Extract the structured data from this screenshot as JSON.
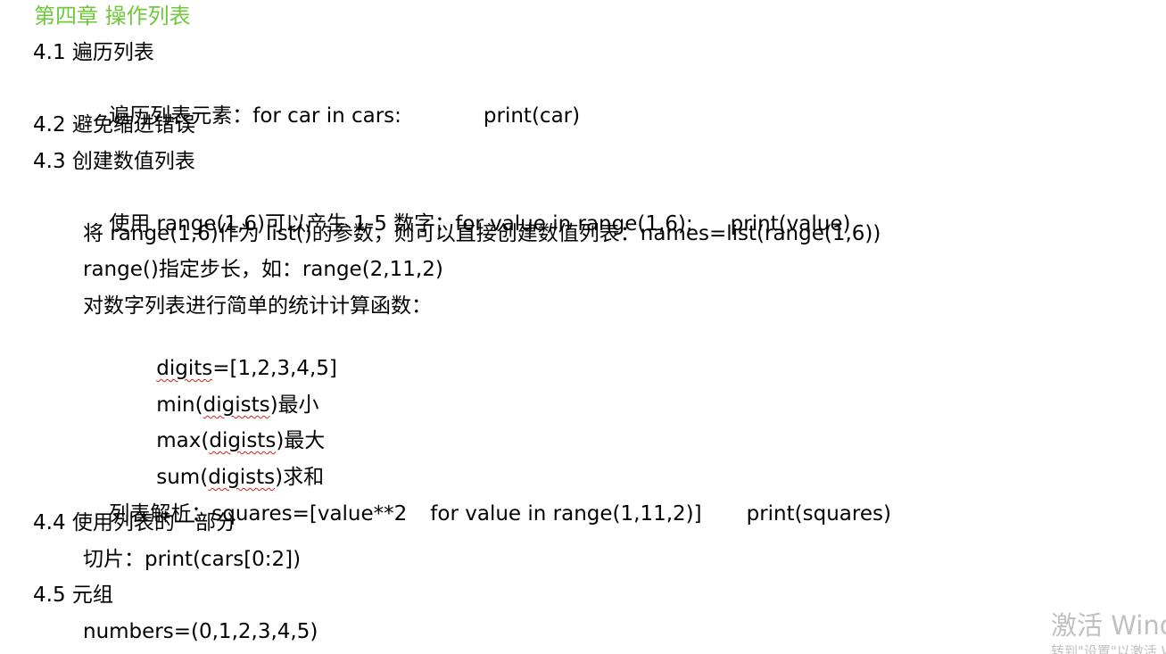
{
  "chapter_title": "第四章 操作列表",
  "colors": {
    "chapter": "#70c83c",
    "text": "#000000",
    "watermark": "#c0c0c0",
    "spell_underline": "#cc2222"
  },
  "s41": {
    "heading": "4.1 遍历列表",
    "loop_text": "遍历列表元素：for car in cars:",
    "loop_code": "print(car)"
  },
  "s42": {
    "heading": "4.2 避免缩进错误"
  },
  "s43": {
    "heading": "4.3 创建数值列表",
    "range_text": "使用 range(1,6)可以产生 1-5 数字：for value in range(1,6):",
    "range_code": "print(value)",
    "list_text": "将 range(1,6)作为 list()的参数，则可以直接创建数值列表：names=list(range(1,6))",
    "step_text": "range()指定步长，如：range(2,11,2)",
    "stats_intro": "对数字列表进行简单的统计计算函数：",
    "digits": {
      "word": "digits",
      "rest": "=[1,2,3,4,5]"
    },
    "min": {
      "pre": "min(",
      "word": "digists",
      "post": ")最小"
    },
    "max": {
      "pre": "max(",
      "word": "digists",
      "post": ")最大"
    },
    "sum": {
      "pre": "sum(",
      "word": "digists",
      "post": ")求和"
    },
    "comp_text": "列表解析：squares=[value**2",
    "comp_mid": "for value in range(1,11,2)]",
    "comp_code": "print(squares)"
  },
  "s44": {
    "heading": "4.4 使用列表的一部分",
    "slice_text": "切片：print(cars[0:2])"
  },
  "s45": {
    "heading": "4.5 元组",
    "tuple_text": "numbers=(0,1,2,3,4,5)"
  },
  "watermark": {
    "line1": "激活 Windows",
    "line2": "转到\"设置\"以激活 Windows。"
  }
}
